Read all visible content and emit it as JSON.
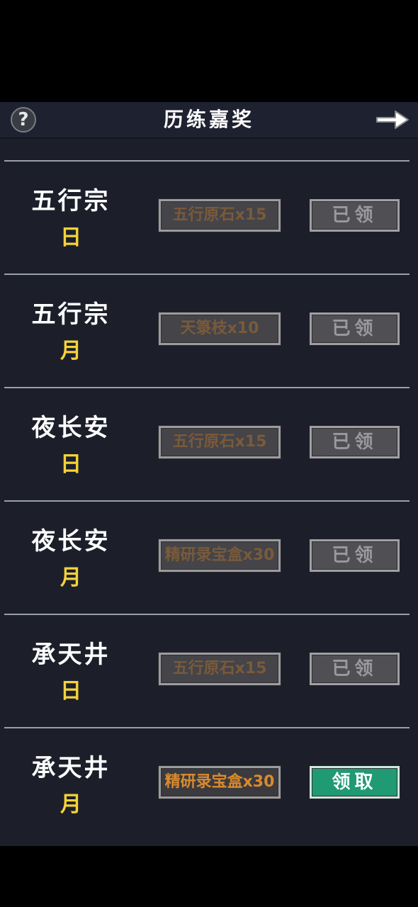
{
  "header": {
    "help_icon": "question-mark-icon",
    "help_glyph": "?",
    "title": "历练嘉奖",
    "back_icon": "arrow-right-icon"
  },
  "colors": {
    "period": "#f5d23a",
    "claim_active": "#1f9a72",
    "reward_active_text": "#d98a2e",
    "reward_muted_text": "#7a5a3a"
  },
  "rows": [
    {
      "name": "五行宗",
      "period": "日",
      "reward": "五行原石x15",
      "button": "已领",
      "claimed": true
    },
    {
      "name": "五行宗",
      "period": "月",
      "reward": "天箓枝x10",
      "button": "已领",
      "claimed": true
    },
    {
      "name": "夜长安",
      "period": "日",
      "reward": "五行原石x15",
      "button": "已领",
      "claimed": true
    },
    {
      "name": "夜长安",
      "period": "月",
      "reward": "精研录宝盒x30",
      "button": "已领",
      "claimed": true
    },
    {
      "name": "承天井",
      "period": "日",
      "reward": "五行原石x15",
      "button": "已领",
      "claimed": true
    },
    {
      "name": "承天井",
      "period": "月",
      "reward": "精研录宝盒x30",
      "button": "领取",
      "claimed": false
    }
  ]
}
